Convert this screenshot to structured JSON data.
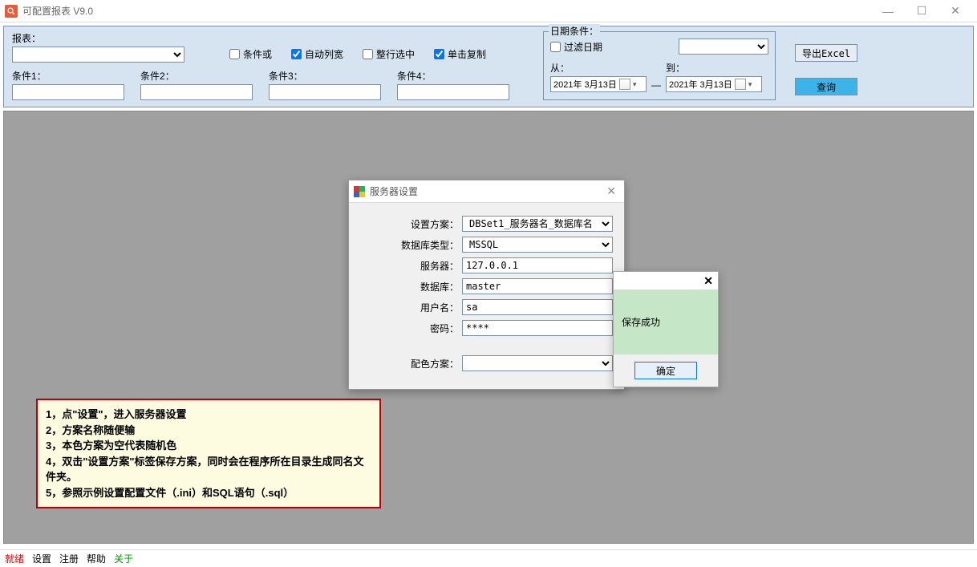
{
  "window": {
    "title": "可配置报表 V9.0"
  },
  "query": {
    "report_label": "报表：",
    "checks": {
      "cond_or": {
        "label": "条件或",
        "checked": false
      },
      "auto_col": {
        "label": "自动列宽",
        "checked": true
      },
      "row_select": {
        "label": "整行选中",
        "checked": false
      },
      "click_copy": {
        "label": "单击复制",
        "checked": true
      }
    },
    "conds": [
      {
        "label": "条件1：",
        "value": ""
      },
      {
        "label": "条件2：",
        "value": ""
      },
      {
        "label": "条件3：",
        "value": ""
      },
      {
        "label": "条件4：",
        "value": ""
      }
    ],
    "date": {
      "legend": "日期条件：",
      "filter_label": "过滤日期",
      "filter_checked": false,
      "from_label": "从：",
      "to_label": "到：",
      "from_value": "2021年 3月13日",
      "to_value": "2021年 3月13日",
      "dash": "—"
    },
    "buttons": {
      "export": "导出Excel",
      "query": "查询"
    }
  },
  "dialog": {
    "title": "服务器设置",
    "fields": {
      "scheme": {
        "label": "设置方案：",
        "value": "DBSet1_服务器名_数据库名"
      },
      "dbtype": {
        "label": "数据库类型：",
        "value": "MSSQL"
      },
      "server": {
        "label": "服务器：",
        "value": "127.0.0.1"
      },
      "database": {
        "label": "数据库：",
        "value": "master"
      },
      "user": {
        "label": "用户名：",
        "value": "sa"
      },
      "password": {
        "label": "密码：",
        "value": "****"
      },
      "color": {
        "label": "配色方案：",
        "value": ""
      }
    }
  },
  "msgbox": {
    "text": "保存成功",
    "ok": "确定"
  },
  "help": {
    "l1": "1，点\"设置\"，进入服务器设置",
    "l2": "2，方案名称随便输",
    "l3": "3，本色方案为空代表随机色",
    "l4": "4，双击\"设置方案\"标签保存方案，同时会在程序所在目录生成同名文件夹。",
    "l5": "5，参照示例设置配置文件（.ini）和SQL语句（.sql）"
  },
  "status": {
    "ready": "就绪",
    "settings": "设置",
    "register": "注册",
    "help": "帮助",
    "about": "关于"
  }
}
